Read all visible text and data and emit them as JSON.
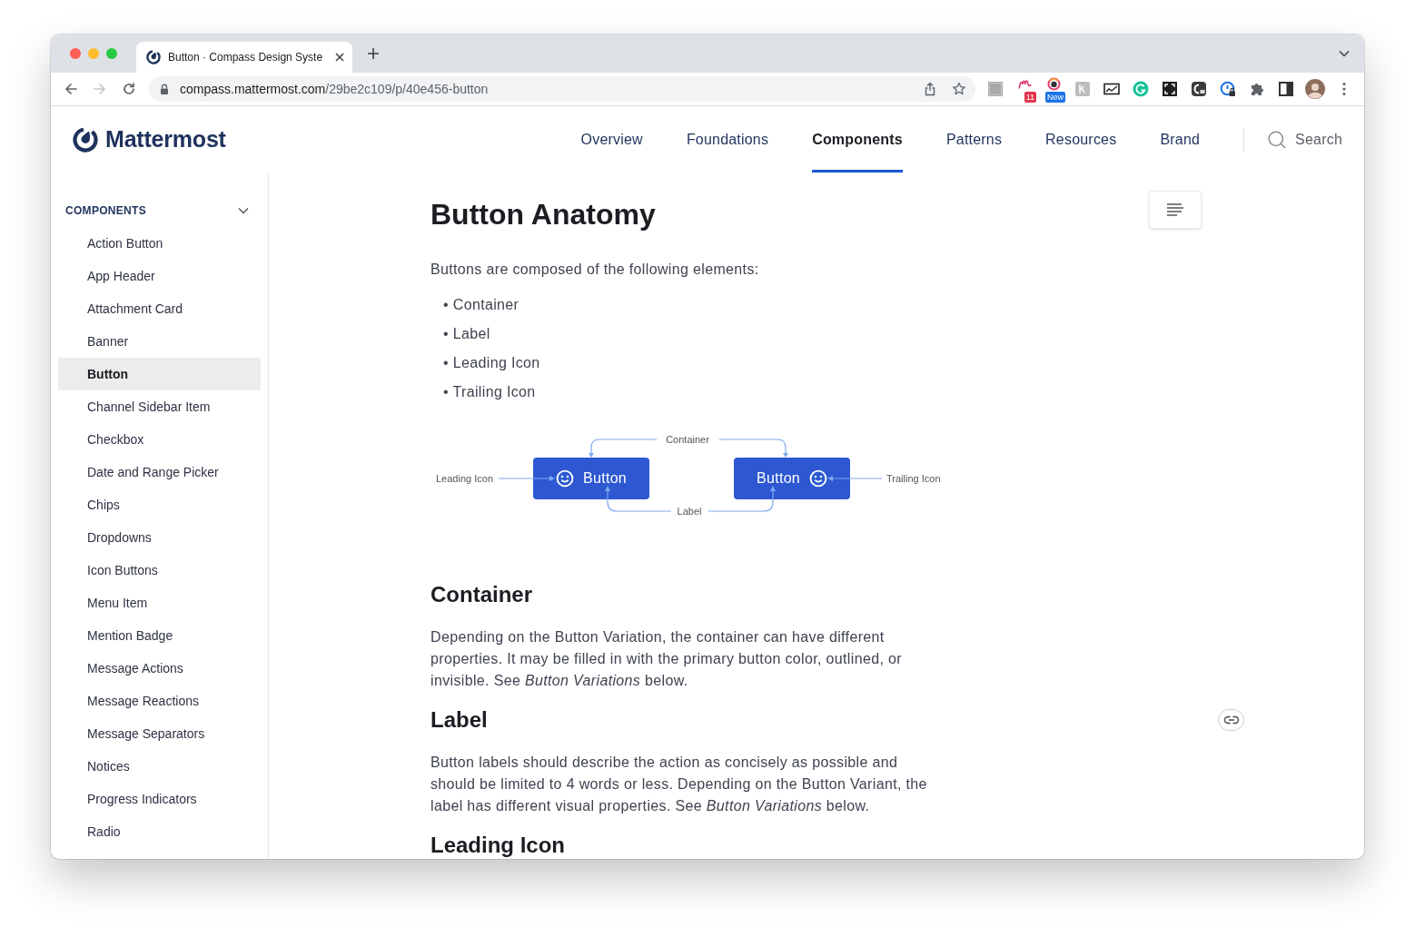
{
  "browser": {
    "tab": {
      "title": "Button · Compass Design Syste"
    },
    "nav_buttons": [
      {
        "kind": "back",
        "disabled": false
      },
      {
        "kind": "forward",
        "disabled": true
      },
      {
        "kind": "reload",
        "disabled": false
      }
    ],
    "url": {
      "host": "compass.mattermost.com",
      "path": "/29be2c109/p/40e456-button"
    },
    "extensions": [
      {
        "kind": "tile"
      },
      {
        "kind": "script",
        "badge": {
          "text": "11",
          "color": "#e5334b"
        }
      },
      {
        "kind": "camera",
        "badge": {
          "text": "New",
          "color": "#1a73e8"
        }
      },
      {
        "kind": "letter"
      },
      {
        "kind": "monitor"
      },
      {
        "kind": "grammar"
      },
      {
        "kind": "expand"
      },
      {
        "kind": "capture"
      },
      {
        "kind": "lock"
      },
      {
        "kind": "puzzle"
      },
      {
        "kind": "panel"
      }
    ]
  },
  "site": {
    "logo": "Mattermost",
    "nav": [
      {
        "label": "Overview",
        "selected": false
      },
      {
        "label": "Foundations",
        "selected": false
      },
      {
        "label": "Components",
        "selected": true
      },
      {
        "label": "Patterns",
        "selected": false
      },
      {
        "label": "Resources",
        "selected": false
      },
      {
        "label": "Brand",
        "selected": false
      }
    ],
    "search": "Search"
  },
  "sidebar": {
    "heading": "COMPONENTS",
    "expanded": true,
    "items": [
      {
        "label": "Action Button",
        "selected": false
      },
      {
        "label": "App Header",
        "selected": false
      },
      {
        "label": "Attachment Card",
        "selected": false
      },
      {
        "label": "Banner",
        "selected": false
      },
      {
        "label": "Button",
        "selected": true
      },
      {
        "label": "Channel Sidebar Item",
        "selected": false
      },
      {
        "label": "Checkbox",
        "selected": false
      },
      {
        "label": "Date and Range Picker",
        "selected": false
      },
      {
        "label": "Chips",
        "selected": false
      },
      {
        "label": "Dropdowns",
        "selected": false
      },
      {
        "label": "Icon Buttons",
        "selected": false
      },
      {
        "label": "Menu Item",
        "selected": false
      },
      {
        "label": "Mention Badge",
        "selected": false
      },
      {
        "label": "Message Actions",
        "selected": false
      },
      {
        "label": "Message Reactions",
        "selected": false
      },
      {
        "label": "Message Separators",
        "selected": false
      },
      {
        "label": "Notices",
        "selected": false
      },
      {
        "label": "Progress Indicators",
        "selected": false
      },
      {
        "label": "Radio",
        "selected": false
      }
    ]
  },
  "article": {
    "title": "Button Anatomy",
    "intro": "Buttons are composed of the following elements:",
    "bullets": [
      "• Container",
      "• Label",
      "• Leading Icon",
      "• Trailing Icon"
    ],
    "diagram": {
      "buttons": [
        {
          "label": "Button",
          "kind": "leading"
        },
        {
          "label": "Button",
          "kind": "trailing"
        }
      ],
      "callouts": [
        {
          "kind": "container",
          "text": "Container"
        },
        {
          "kind": "leading",
          "text": "Leading Icon"
        },
        {
          "kind": "trailing",
          "text": "Trailing Icon"
        },
        {
          "kind": "label",
          "text": "Label"
        }
      ]
    },
    "sections": [
      {
        "heading": "Container",
        "body": "Depending on the Button Variation, the container can have different properties. It may be filled in with the primary button color, outlined, or invisible. See *Button Variations* below."
      },
      {
        "heading": "Label",
        "anchor_link": true,
        "body": "Button labels should describe the action as concisely as possible and should be limited to 4 words or less. Depending on the Button Variant, the label has different visual properties. See *Button Variations* below."
      },
      {
        "heading": "Leading Icon"
      }
    ]
  }
}
